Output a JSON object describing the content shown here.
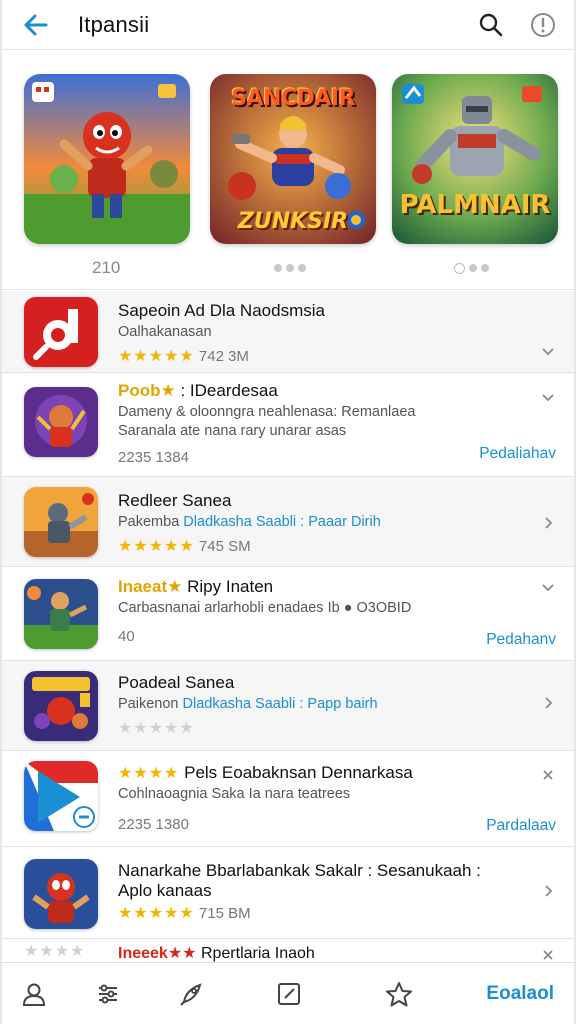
{
  "header": {
    "title": "Itpansii",
    "back_icon": "arrow-left-icon",
    "search_icon": "search-icon",
    "info_icon": "info-icon",
    "accent": "#1a8fd1"
  },
  "carousel": {
    "label": "210",
    "tiles": [
      {
        "name": "red-brawler-art"
      },
      {
        "name": "sancdair-art",
        "top_text": "SANCDAIR",
        "bottom_text": "ZUNKSIR"
      },
      {
        "name": "robot-knight-art",
        "bottom_text": "PALMNAIR"
      }
    ]
  },
  "apps": [
    {
      "name": "Sapeoin Ad Dla Naodsmsia",
      "subtitle": "Oalhakanasan",
      "stars": "★★★★★",
      "meta": "742 3M",
      "chevron": "chevron-down-icon"
    },
    {
      "name_prefix": "Poob★",
      "name": ": IDeardesaa",
      "subtitle": "Dameny & oloonngra neahlenasa: Remanlaea",
      "subtitle2": "Saranala ate nana rary unarar asas",
      "meta": "2235 1384",
      "action": "Pedaliahav",
      "chevron": "chevron-down-icon"
    },
    {
      "name": "Redleer Sanea",
      "subtitle_a": "Pakemba",
      "subtitle_b": "Dladkasha Saabli : Paaar Dirih",
      "stars": "★★★★★",
      "meta": "745 SM",
      "chevron": "chevron-right-icon"
    },
    {
      "name_prefix": "Inaeat★",
      "name": "Ripy Inaten",
      "subtitle": "Carbasnanai arlarhobli enadaes Ib ● O3OBID",
      "meta": "40",
      "action": "Pedahanv",
      "chevron": "chevron-down-icon"
    },
    {
      "name": "Poadeal Sanea",
      "subtitle_a": "Paikenon",
      "subtitle_b": "Dladkasha Saabli : Papp bairh",
      "stars": "★★★★★",
      "chevron": "chevron-right-icon"
    },
    {
      "stars_prefix": "★★★★",
      "name": "Pels Eoabaknsan Dennarkasa",
      "subtitle": "Cohlnaoagnia Saka Ia nara teatrees",
      "meta": "2235 1380",
      "action": "Pardalaav",
      "chevron": "close-icon"
    },
    {
      "name": "Nanarkahe Bbarlabankak Sakalr : Sesanukaah :",
      "name2": "Aplo kanaas",
      "stars": "★★★★★",
      "meta": "715 BM",
      "chevron": "chevron-right-icon"
    },
    {
      "stars_prefix": "★★★★",
      "name_prefix": "Ineeek★★",
      "name": "Rpertlaria Inaoh",
      "chevron": "close-icon"
    }
  ],
  "bottom_nav": {
    "items": [
      "person-icon",
      "filter-list-icon",
      "rocket-icon",
      "edit-square-icon",
      "star-icon"
    ],
    "label": "Eoalaol"
  }
}
